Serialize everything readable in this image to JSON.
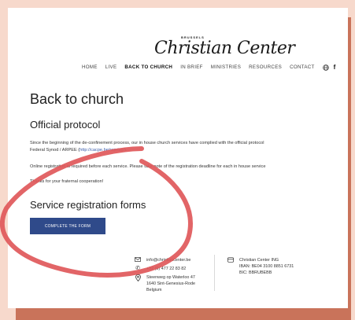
{
  "logo": {
    "tagline": "BRUSSELS",
    "name": "Christian Center"
  },
  "nav": {
    "items": [
      {
        "label": "HOME"
      },
      {
        "label": "LIVE"
      },
      {
        "label": "BACK TO CHURCH"
      },
      {
        "label": "IN BRIEF"
      },
      {
        "label": "MINISTRIES"
      },
      {
        "label": "RESOURCES"
      },
      {
        "label": "CONTACT"
      }
    ],
    "active": "BACK TO CHURCH",
    "globe_icon": "globe-icon",
    "facebook_icon": "facebook-icon",
    "facebook_glyph": "f"
  },
  "main": {
    "title": "Back to church",
    "protocol_heading": "Official protocol",
    "protocol_text_1": "Since the beginning of the de-confinement process, our in house church services have complied with the official protocol",
    "protocol_text_2_prefix": "Federal Synod / ARPEE (",
    "protocol_link": "http://cacpe.be/reprise/",
    "protocol_text_2_suffix": ").",
    "registration_text": "Online registration is required before each service. Please take note of the registration deadline for each in house service",
    "thanks_text": "Thanks for your fraternal cooperation!",
    "forms_heading": "Service registration forms",
    "cta_label": "COMPLETE THE FORM"
  },
  "footer": {
    "email": "info@christiancenter.be",
    "phone": "+32 (0) 477 22 83 82",
    "address_line1": "Steenweg op Waterloo 47",
    "address_line2": "1640 Sint-Genesius-Rode",
    "address_line3": "Belgium",
    "bank_name": "Christian Center ING",
    "iban": "IBAN: BE04 3100 8851 6731",
    "bic": "BIC: BBRUBEBB"
  },
  "colors": {
    "background": "#f7d9cc",
    "shadow_block": "#c9735a",
    "cta": "#2f4a8a",
    "scribble": "#e0585a",
    "link": "#3a5cab"
  }
}
